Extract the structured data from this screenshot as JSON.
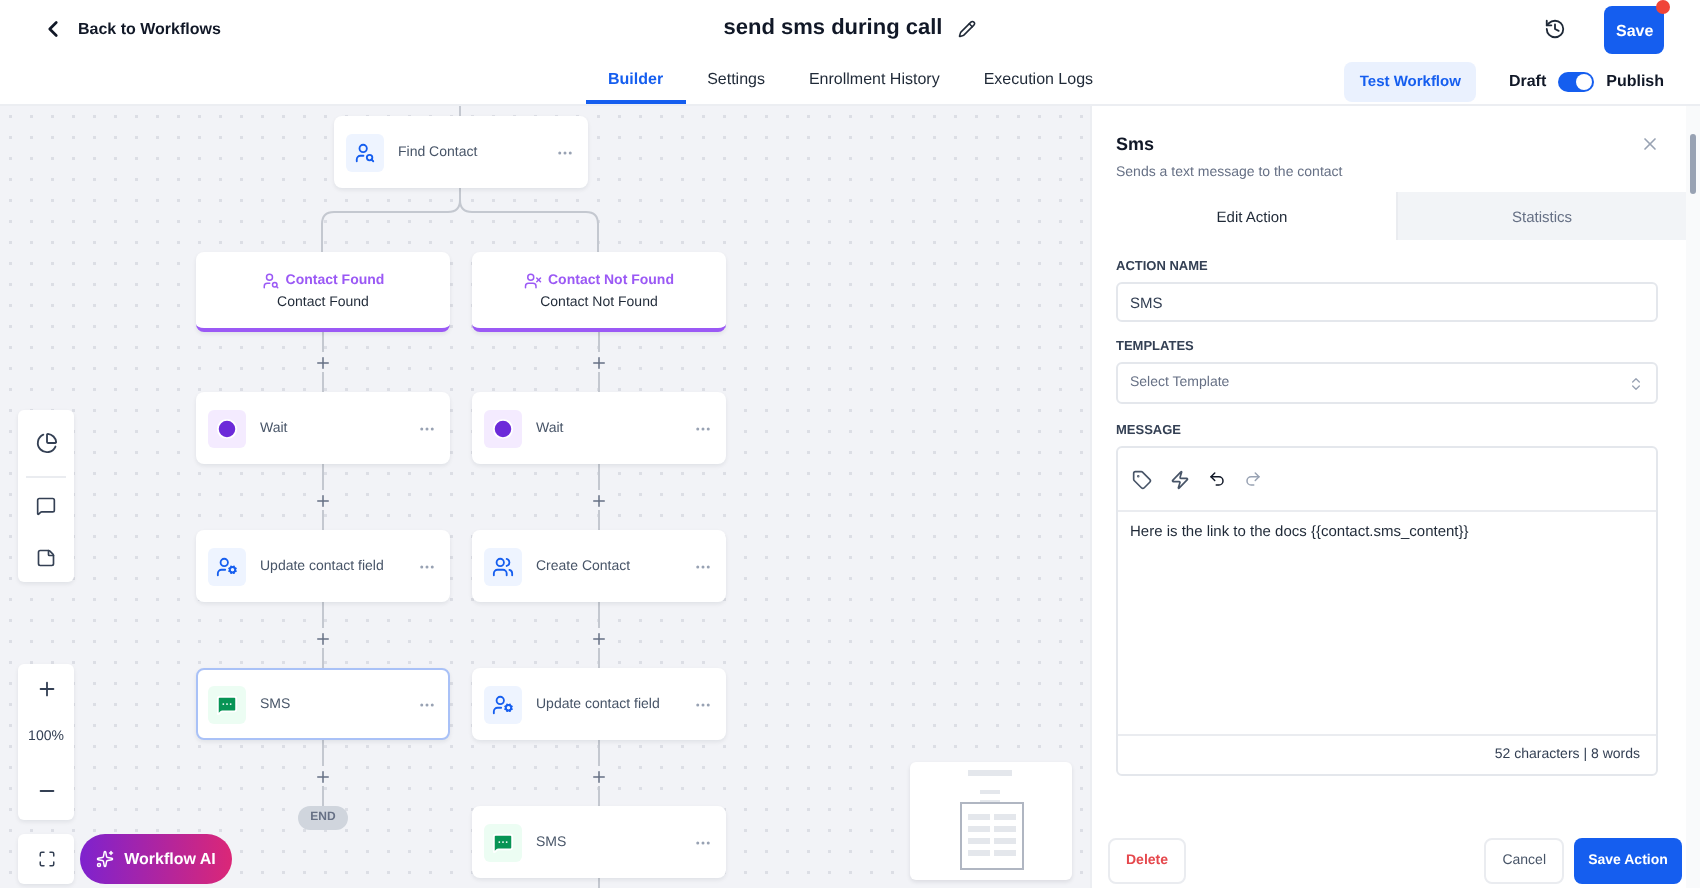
{
  "header": {
    "back_label": "Back to Workflows",
    "title": "send sms during call",
    "save_label": "Save",
    "save_notification": true
  },
  "tabs": [
    {
      "label": "Builder",
      "selected": true
    },
    {
      "label": "Settings",
      "selected": false
    },
    {
      "label": "Enrollment History",
      "selected": false
    },
    {
      "label": "Execution Logs",
      "selected": false
    }
  ],
  "test_button": "Test Workflow",
  "publish_toggle": {
    "off_label": "Draft",
    "on_label": "Publish",
    "on": true
  },
  "canvas": {
    "trigger_node": {
      "label": "Find Contact"
    },
    "branches": [
      {
        "title": "Contact Found",
        "subtitle": "Contact Found",
        "kind": "found",
        "steps": [
          {
            "kind": "wait",
            "label": "Wait",
            "selected": false
          },
          {
            "kind": "update_contact",
            "label": "Update contact field",
            "selected": false
          },
          {
            "kind": "sms",
            "label": "SMS",
            "selected": true
          }
        ],
        "end_label": "END"
      },
      {
        "title": "Contact Not Found",
        "subtitle": "Contact Not Found",
        "kind": "not_found",
        "steps": [
          {
            "kind": "wait",
            "label": "Wait",
            "selected": false
          },
          {
            "kind": "create_contact",
            "label": "Create Contact",
            "selected": false
          },
          {
            "kind": "update_contact",
            "label": "Update contact field",
            "selected": false
          },
          {
            "kind": "sms",
            "label": "SMS",
            "selected": false
          }
        ]
      }
    ],
    "zoom_level": "100%",
    "ai_button": "Workflow AI"
  },
  "panel": {
    "title": "Sms",
    "subtitle": "Sends a text message to the contact",
    "tabs": [
      {
        "label": "Edit Action",
        "selected": true
      },
      {
        "label": "Statistics",
        "selected": false
      }
    ],
    "action_name_label": "ACTION NAME",
    "action_name_value": "SMS",
    "templates_label": "TEMPLATES",
    "templates_placeholder": "Select Template",
    "message_label": "MESSAGE",
    "message_value": "Here is the link to the docs {{contact.sms_content}}",
    "message_count": "52 characters | 8 words",
    "delete_button": "Delete",
    "cancel_button": "Cancel",
    "save_button": "Save Action"
  }
}
